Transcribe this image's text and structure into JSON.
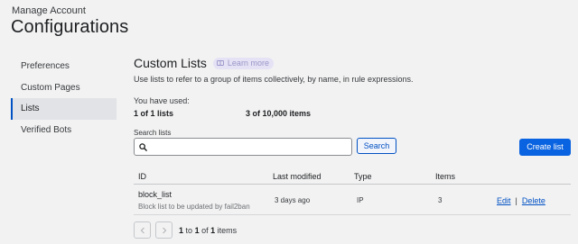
{
  "header": {
    "subtitle": "Manage Account",
    "title": "Configurations"
  },
  "nav": {
    "items": [
      {
        "label": "Preferences",
        "active": false
      },
      {
        "label": "Custom Pages",
        "active": false
      },
      {
        "label": "Lists",
        "active": true
      },
      {
        "label": "Verified Bots",
        "active": false
      }
    ]
  },
  "main": {
    "title": "Custom Lists",
    "learn_more": "Learn more",
    "description": "Use lists to refer to a group of items collectively, by name, in rule expressions.",
    "usage": {
      "label": "You have used:",
      "lists_count": "1",
      "lists_text": "of 1 lists",
      "items_count": "3",
      "items_text": "of 10,000 items"
    },
    "search": {
      "label": "Search lists",
      "value": "",
      "placeholder": "",
      "button": "Search"
    },
    "create_button": "Create list",
    "table": {
      "columns": [
        "ID",
        "Last modified",
        "Type",
        "Items"
      ],
      "rows": [
        {
          "id": "block_list",
          "description": "Block list to be updated by fail2ban",
          "last_modified": "3 days ago",
          "type": "IP",
          "items": "3",
          "edit": "Edit",
          "separator": "|",
          "delete": "Delete"
        }
      ]
    },
    "pagination": {
      "from": "1",
      "to_word": "to",
      "to": "1",
      "of_word": "of",
      "total": "1",
      "suffix": "items"
    }
  },
  "colors": {
    "accent": "#0051c3",
    "primary_button": "#0a63e0",
    "background": "#f2f2f3",
    "learn_more_pill": "#e4e2f4"
  }
}
